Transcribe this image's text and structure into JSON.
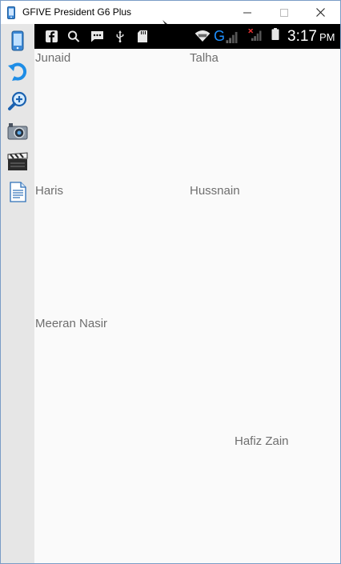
{
  "window": {
    "title": "GFIVE President G6 Plus"
  },
  "sidebar": {
    "buttons": [
      {
        "icon": "phone-icon"
      },
      {
        "icon": "rotate-icon"
      },
      {
        "icon": "zoom-in-icon"
      },
      {
        "icon": "camera-icon"
      },
      {
        "icon": "clapperboard-icon"
      },
      {
        "icon": "document-icon"
      }
    ]
  },
  "status_bar": {
    "icons_left": [
      "facebook-icon",
      "search-icon",
      "message-icon",
      "usb-icon",
      "sd-card-icon"
    ],
    "icons_right": [
      "wifi-icon",
      "network-g-icon",
      "signal-icon",
      "signal-no-service-icon",
      "battery-icon"
    ],
    "network_type": "G",
    "time": "3:17",
    "ampm": "PM"
  },
  "contacts": [
    {
      "name": "Junaid"
    },
    {
      "name": "Talha"
    },
    {
      "name": "Haris"
    },
    {
      "name": "Hussnain"
    },
    {
      "name": "Meeran Nasir"
    },
    {
      "name": "Hafiz Zain"
    }
  ],
  "colors": {
    "name_text": "#6e6e6e",
    "status_bar_bg": "#000000",
    "screen_bg": "#fafafa",
    "sidebar_bg": "#e6e6e6",
    "accent_blue": "#1e90ff"
  }
}
